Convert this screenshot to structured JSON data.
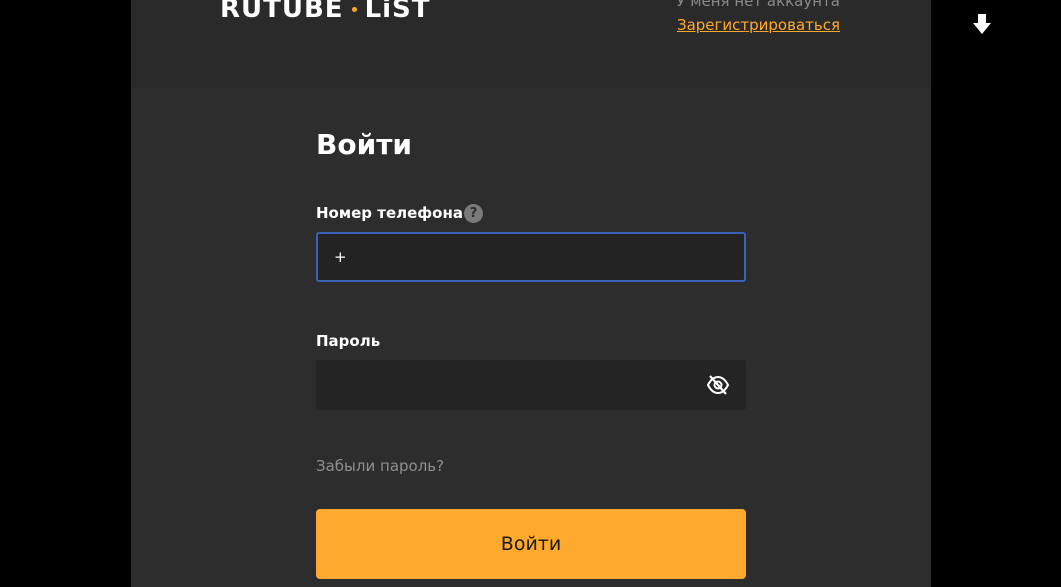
{
  "colors": {
    "accent": "#ffa92e",
    "logo_dot": "#ffa92e",
    "input_focus_border": "#3a63b8"
  },
  "header": {
    "logo_left": "RUTUBE",
    "logo_right": "LiST",
    "no_account_text": "У меня нет аккаунта",
    "register_link": "Зарегистрироваться"
  },
  "login": {
    "title": "Войти",
    "phone_label": "Номер телефона",
    "help_icon_glyph": "?",
    "phone_value": "+",
    "password_label": "Пароль",
    "password_value": "",
    "forgot_link": "Забыли пароль?",
    "submit_label": "Войти"
  },
  "icons": {
    "help": "question-mark-icon",
    "password_visibility": "eye-slash-icon",
    "download": "down-arrow-icon"
  }
}
